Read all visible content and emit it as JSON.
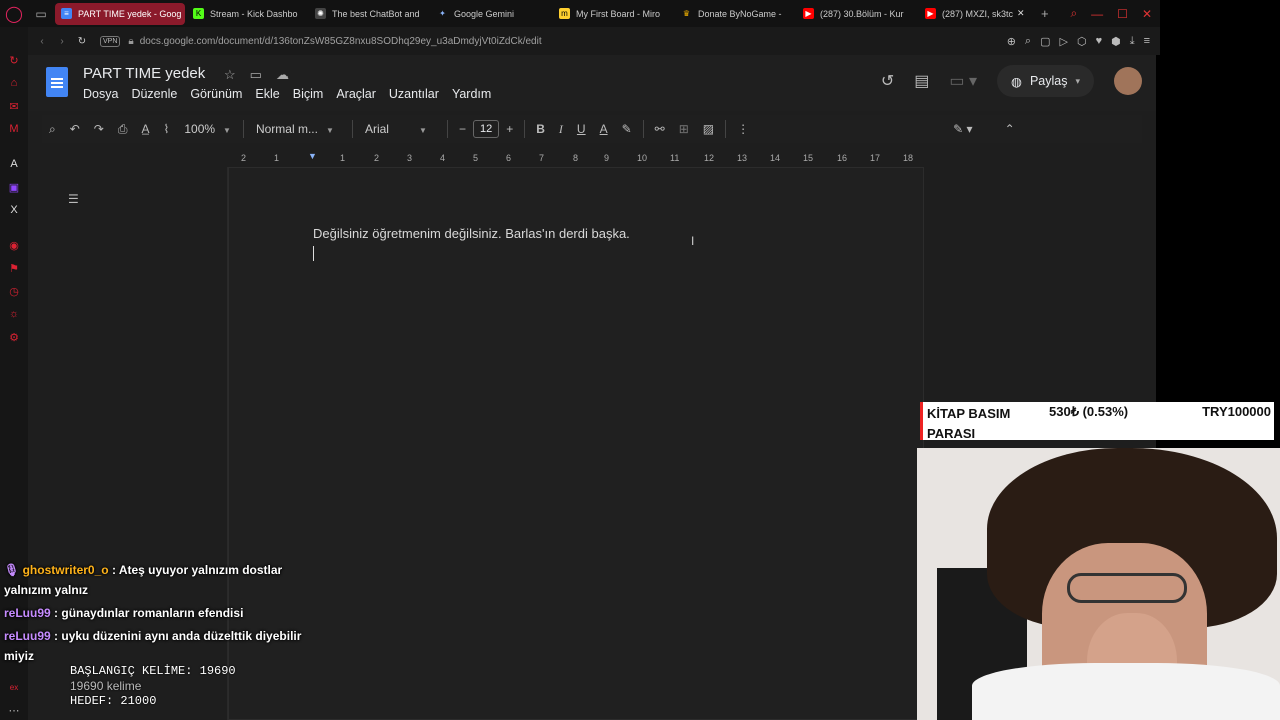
{
  "browser": {
    "tabs": [
      {
        "label": "PART TIME yedek - Goog",
        "active": true,
        "color": "#4285f4"
      },
      {
        "label": "Stream - Kick Dashbo",
        "color": "#53fc18"
      },
      {
        "label": "The best ChatBot and",
        "color": "#ffffff"
      },
      {
        "label": "Google Gemini",
        "color": "#8ab4f8"
      },
      {
        "label": "My First Board - Miro",
        "color": "#ffd02f"
      },
      {
        "label": "Donate ByNoGame - ",
        "color": "#f4b400"
      },
      {
        "label": "(287) 30.Bölüm - Kur",
        "color": "#ff0000"
      },
      {
        "label": "(287) MXZI, sk3tc",
        "color": "#ff0000"
      }
    ],
    "url": "docs.google.com/document/d/136tonZsW85GZ8nxu8SODhq29ey_u3aDmdyjVt0iZdCk/edit",
    "vpn": "VPN"
  },
  "docs": {
    "title": "PART TIME  yedek",
    "menu": [
      "Dosya",
      "Düzenle",
      "Görünüm",
      "Ekle",
      "Biçim",
      "Araçlar",
      "Uzantılar",
      "Yardım"
    ],
    "share_label": "Paylaş",
    "toolbar": {
      "zoom": "100%",
      "style": "Normal m...",
      "font": "Arial",
      "font_size": "12"
    },
    "ruler": [
      "2",
      "1",
      "1",
      "2",
      "3",
      "4",
      "5",
      "6",
      "7",
      "8",
      "9",
      "10",
      "11",
      "12",
      "13",
      "14",
      "15",
      "16",
      "17",
      "18"
    ],
    "body_text": "Değilsiniz öğretmenim değilsiniz. Barlas'ın derdi başka."
  },
  "overlay": {
    "donation": {
      "label": "KİTAP BASIM PARASI",
      "amount": "530₺ (0.53%)",
      "goal": "TRY100000"
    },
    "chat": [
      {
        "user": "ghostwriter0_o",
        "user_color": "#ffb31a",
        "text": ": Ateş uyuyor yalnızım dostlar yalnızım yalnız"
      },
      {
        "user": "reLuu99",
        "user_color": "#c68cff",
        "text": ": günaydınlar romanların efendisi"
      },
      {
        "user": "reLuu99",
        "user_color": "#c68cff",
        "text": ": uyku düzenini aynı anda düzelttik diyebilir miyiz"
      }
    ],
    "wordcount": {
      "start": "BAŞLANGIÇ KELİME: 19690",
      "current": "19690 kelime",
      "target": "HEDEF: 21000"
    }
  }
}
